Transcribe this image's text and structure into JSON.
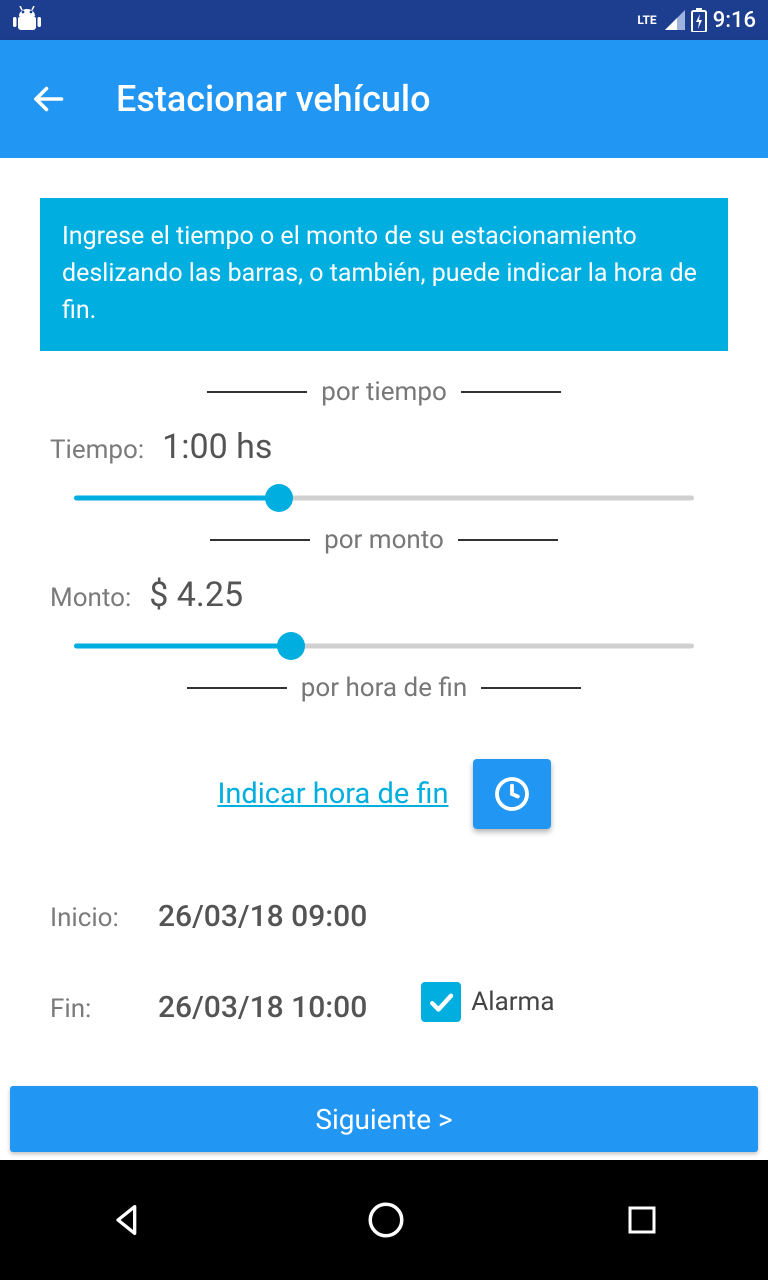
{
  "status": {
    "time": "9:16",
    "net": "LTE"
  },
  "appbar": {
    "title": "Estacionar vehículo"
  },
  "info": "Ingrese el tiempo o el monto de su estacionamiento deslizando las barras, o también, puede indicar la hora de fin.",
  "separators": {
    "time": "por tiempo",
    "amount": "por monto",
    "end": "por hora de fin"
  },
  "time": {
    "label": "Tiempo:",
    "value": "1:00 hs",
    "percent": 33
  },
  "amount": {
    "label": "Monto:",
    "value": "$ 4.25",
    "percent": 35
  },
  "endtime": {
    "link": "Indicar hora de fin"
  },
  "start": {
    "label": "Inicio:",
    "value": "26/03/18 09:00"
  },
  "end": {
    "label": "Fin:",
    "value": "26/03/18 10:00"
  },
  "alarm": {
    "label": "Alarma",
    "checked": true
  },
  "next": "Siguiente >"
}
